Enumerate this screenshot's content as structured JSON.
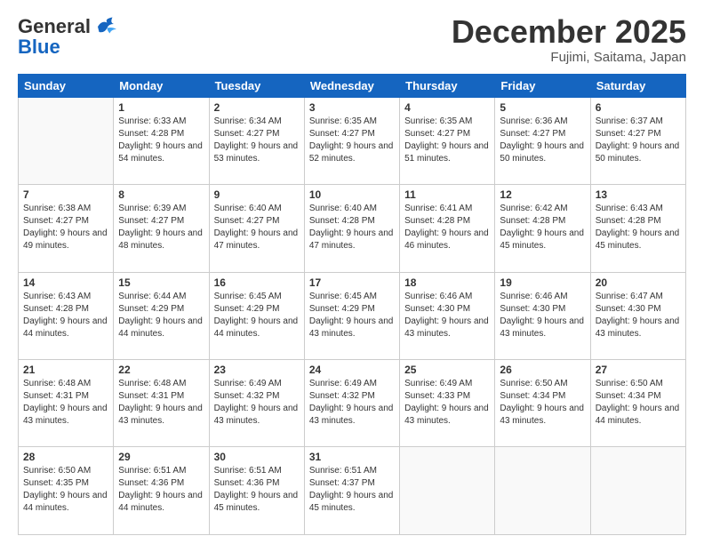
{
  "header": {
    "logo_general": "General",
    "logo_blue": "Blue",
    "month_title": "December 2025",
    "location": "Fujimi, Saitama, Japan"
  },
  "weekdays": [
    "Sunday",
    "Monday",
    "Tuesday",
    "Wednesday",
    "Thursday",
    "Friday",
    "Saturday"
  ],
  "weeks": [
    [
      {
        "day": "",
        "sunrise": "",
        "sunset": "",
        "daylight": ""
      },
      {
        "day": "1",
        "sunrise": "Sunrise: 6:33 AM",
        "sunset": "Sunset: 4:28 PM",
        "daylight": "Daylight: 9 hours and 54 minutes."
      },
      {
        "day": "2",
        "sunrise": "Sunrise: 6:34 AM",
        "sunset": "Sunset: 4:27 PM",
        "daylight": "Daylight: 9 hours and 53 minutes."
      },
      {
        "day": "3",
        "sunrise": "Sunrise: 6:35 AM",
        "sunset": "Sunset: 4:27 PM",
        "daylight": "Daylight: 9 hours and 52 minutes."
      },
      {
        "day": "4",
        "sunrise": "Sunrise: 6:35 AM",
        "sunset": "Sunset: 4:27 PM",
        "daylight": "Daylight: 9 hours and 51 minutes."
      },
      {
        "day": "5",
        "sunrise": "Sunrise: 6:36 AM",
        "sunset": "Sunset: 4:27 PM",
        "daylight": "Daylight: 9 hours and 50 minutes."
      },
      {
        "day": "6",
        "sunrise": "Sunrise: 6:37 AM",
        "sunset": "Sunset: 4:27 PM",
        "daylight": "Daylight: 9 hours and 50 minutes."
      }
    ],
    [
      {
        "day": "7",
        "sunrise": "Sunrise: 6:38 AM",
        "sunset": "Sunset: 4:27 PM",
        "daylight": "Daylight: 9 hours and 49 minutes."
      },
      {
        "day": "8",
        "sunrise": "Sunrise: 6:39 AM",
        "sunset": "Sunset: 4:27 PM",
        "daylight": "Daylight: 9 hours and 48 minutes."
      },
      {
        "day": "9",
        "sunrise": "Sunrise: 6:40 AM",
        "sunset": "Sunset: 4:27 PM",
        "daylight": "Daylight: 9 hours and 47 minutes."
      },
      {
        "day": "10",
        "sunrise": "Sunrise: 6:40 AM",
        "sunset": "Sunset: 4:28 PM",
        "daylight": "Daylight: 9 hours and 47 minutes."
      },
      {
        "day": "11",
        "sunrise": "Sunrise: 6:41 AM",
        "sunset": "Sunset: 4:28 PM",
        "daylight": "Daylight: 9 hours and 46 minutes."
      },
      {
        "day": "12",
        "sunrise": "Sunrise: 6:42 AM",
        "sunset": "Sunset: 4:28 PM",
        "daylight": "Daylight: 9 hours and 45 minutes."
      },
      {
        "day": "13",
        "sunrise": "Sunrise: 6:43 AM",
        "sunset": "Sunset: 4:28 PM",
        "daylight": "Daylight: 9 hours and 45 minutes."
      }
    ],
    [
      {
        "day": "14",
        "sunrise": "Sunrise: 6:43 AM",
        "sunset": "Sunset: 4:28 PM",
        "daylight": "Daylight: 9 hours and 44 minutes."
      },
      {
        "day": "15",
        "sunrise": "Sunrise: 6:44 AM",
        "sunset": "Sunset: 4:29 PM",
        "daylight": "Daylight: 9 hours and 44 minutes."
      },
      {
        "day": "16",
        "sunrise": "Sunrise: 6:45 AM",
        "sunset": "Sunset: 4:29 PM",
        "daylight": "Daylight: 9 hours and 44 minutes."
      },
      {
        "day": "17",
        "sunrise": "Sunrise: 6:45 AM",
        "sunset": "Sunset: 4:29 PM",
        "daylight": "Daylight: 9 hours and 43 minutes."
      },
      {
        "day": "18",
        "sunrise": "Sunrise: 6:46 AM",
        "sunset": "Sunset: 4:30 PM",
        "daylight": "Daylight: 9 hours and 43 minutes."
      },
      {
        "day": "19",
        "sunrise": "Sunrise: 6:46 AM",
        "sunset": "Sunset: 4:30 PM",
        "daylight": "Daylight: 9 hours and 43 minutes."
      },
      {
        "day": "20",
        "sunrise": "Sunrise: 6:47 AM",
        "sunset": "Sunset: 4:30 PM",
        "daylight": "Daylight: 9 hours and 43 minutes."
      }
    ],
    [
      {
        "day": "21",
        "sunrise": "Sunrise: 6:48 AM",
        "sunset": "Sunset: 4:31 PM",
        "daylight": "Daylight: 9 hours and 43 minutes."
      },
      {
        "day": "22",
        "sunrise": "Sunrise: 6:48 AM",
        "sunset": "Sunset: 4:31 PM",
        "daylight": "Daylight: 9 hours and 43 minutes."
      },
      {
        "day": "23",
        "sunrise": "Sunrise: 6:49 AM",
        "sunset": "Sunset: 4:32 PM",
        "daylight": "Daylight: 9 hours and 43 minutes."
      },
      {
        "day": "24",
        "sunrise": "Sunrise: 6:49 AM",
        "sunset": "Sunset: 4:32 PM",
        "daylight": "Daylight: 9 hours and 43 minutes."
      },
      {
        "day": "25",
        "sunrise": "Sunrise: 6:49 AM",
        "sunset": "Sunset: 4:33 PM",
        "daylight": "Daylight: 9 hours and 43 minutes."
      },
      {
        "day": "26",
        "sunrise": "Sunrise: 6:50 AM",
        "sunset": "Sunset: 4:34 PM",
        "daylight": "Daylight: 9 hours and 43 minutes."
      },
      {
        "day": "27",
        "sunrise": "Sunrise: 6:50 AM",
        "sunset": "Sunset: 4:34 PM",
        "daylight": "Daylight: 9 hours and 44 minutes."
      }
    ],
    [
      {
        "day": "28",
        "sunrise": "Sunrise: 6:50 AM",
        "sunset": "Sunset: 4:35 PM",
        "daylight": "Daylight: 9 hours and 44 minutes."
      },
      {
        "day": "29",
        "sunrise": "Sunrise: 6:51 AM",
        "sunset": "Sunset: 4:36 PM",
        "daylight": "Daylight: 9 hours and 44 minutes."
      },
      {
        "day": "30",
        "sunrise": "Sunrise: 6:51 AM",
        "sunset": "Sunset: 4:36 PM",
        "daylight": "Daylight: 9 hours and 45 minutes."
      },
      {
        "day": "31",
        "sunrise": "Sunrise: 6:51 AM",
        "sunset": "Sunset: 4:37 PM",
        "daylight": "Daylight: 9 hours and 45 minutes."
      },
      {
        "day": "",
        "sunrise": "",
        "sunset": "",
        "daylight": ""
      },
      {
        "day": "",
        "sunrise": "",
        "sunset": "",
        "daylight": ""
      },
      {
        "day": "",
        "sunrise": "",
        "sunset": "",
        "daylight": ""
      }
    ]
  ]
}
